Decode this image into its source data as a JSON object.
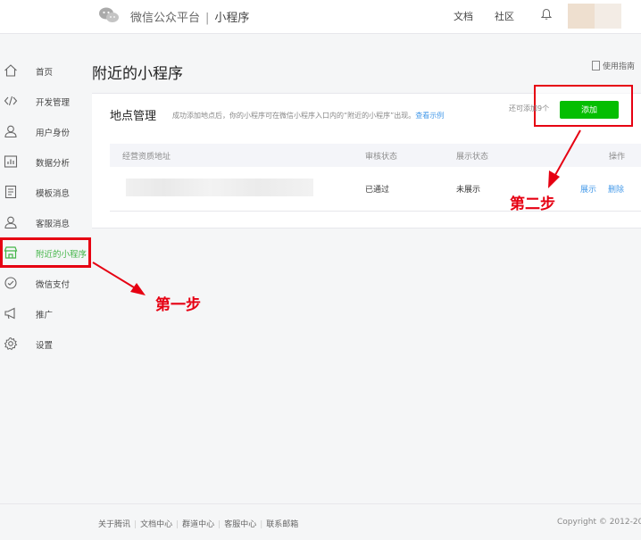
{
  "header": {
    "brand": "微信公众平台",
    "separator": "|",
    "subtitle": "小程序",
    "links": [
      "文档",
      "社区"
    ]
  },
  "sidebar": {
    "items": [
      {
        "label": "首页",
        "icon": "home-icon"
      },
      {
        "label": "开发管理",
        "icon": "code-icon"
      },
      {
        "label": "用户身份",
        "icon": "user-icon"
      },
      {
        "label": "数据分析",
        "icon": "chart-icon"
      },
      {
        "label": "模板消息",
        "icon": "template-icon"
      },
      {
        "label": "客服消息",
        "icon": "service-icon"
      },
      {
        "label": "附近的小程序",
        "icon": "store-icon",
        "active": true
      },
      {
        "label": "微信支付",
        "icon": "pay-icon"
      },
      {
        "label": "推广",
        "icon": "megaphone-icon"
      },
      {
        "label": "设置",
        "icon": "gear-icon"
      }
    ]
  },
  "main": {
    "title": "附近的小程序",
    "guide": "使用指南",
    "section": {
      "title": "地点管理",
      "desc": "成功添加地点后，你的小程序可在微信小程序入口内的“附近的小程序”出现。",
      "example_link": "查看示例",
      "remain": "还可添加9个",
      "add_button": "添加"
    },
    "table": {
      "headers": [
        "经营资质地址",
        "审核状态",
        "展示状态",
        "操作"
      ],
      "rows": [
        {
          "status": "已通过",
          "display": "未展示",
          "actions": [
            "展示",
            "删除"
          ]
        }
      ]
    }
  },
  "annotations": {
    "step1": "第一步",
    "step2": "第二步",
    "color": "#e60012"
  },
  "footer": {
    "links": [
      "关于腾讯",
      "文档中心",
      "群道中心",
      "客服中心",
      "联系邮箱"
    ],
    "copyright": "Copyright © 2012-20"
  },
  "colors": {
    "accent_green": "#44b549",
    "button_green": "#04be02",
    "link_blue": "#459ae9"
  }
}
